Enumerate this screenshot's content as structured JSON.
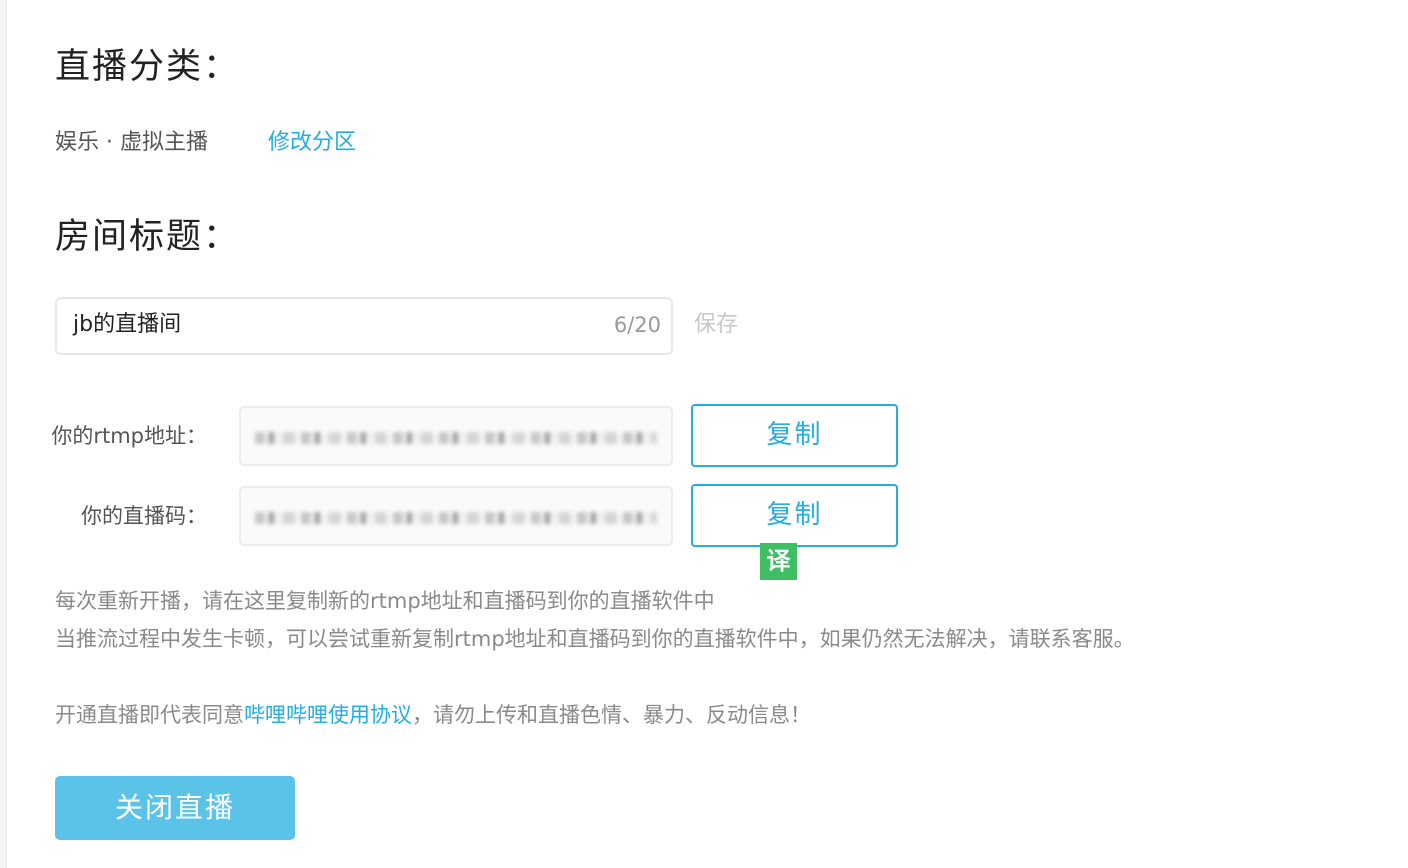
{
  "category": {
    "heading": "直播分类：",
    "current": "娱乐 · 虚拟主播",
    "change_link": "修改分区"
  },
  "room_title": {
    "heading": "房间标题：",
    "value": "jb的直播间",
    "counter": "6/20",
    "save_label": "保存"
  },
  "stream": {
    "rtmp_label": "你的rtmp地址：",
    "key_label": "你的直播码：",
    "copy_label": "复制",
    "translate_badge": "译"
  },
  "notes": {
    "line1": "每次重新开播，请在这里复制新的rtmp地址和直播码到你的直播软件中",
    "line2": "当推流过程中发生卡顿，可以尝试重新复制rtmp地址和直播码到你的直播软件中，如果仍然无法解决，请联系客服。",
    "agreement_prefix": "开通直播即代表同意",
    "agreement_link": "哔哩哔哩使用协议",
    "agreement_suffix": "，请勿上传和直播色情、暴力、反动信息！"
  },
  "actions": {
    "close_label": "关闭直播"
  },
  "colors": {
    "accent": "#23ade5",
    "close_button": "#5bc2e8",
    "translate_badge": "#3fbe63"
  }
}
